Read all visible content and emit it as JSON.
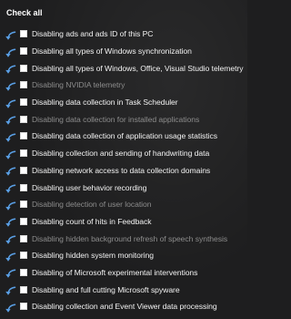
{
  "header": {
    "check_all_label": "Check all"
  },
  "items": [
    {
      "label": "Disabling ads and ads ID of this PC",
      "dim": false
    },
    {
      "label": "Disabling all types of Windows synchronization",
      "dim": false
    },
    {
      "label": "Disabling all types of Windows, Office, Visual Studio telemetry",
      "dim": false
    },
    {
      "label": "Disabling NVIDIA telemetry",
      "dim": true
    },
    {
      "label": "Disabling data collection in Task Scheduler",
      "dim": false
    },
    {
      "label": "Disabling data collection for installed applications",
      "dim": true
    },
    {
      "label": "Disabling data collection of application usage statistics",
      "dim": false
    },
    {
      "label": "Disabling collection and sending of handwriting data",
      "dim": false
    },
    {
      "label": "Disabling network access to data collection domains",
      "dim": false
    },
    {
      "label": "Disabling user behavior recording",
      "dim": false
    },
    {
      "label": "Disabling detection of user location",
      "dim": true
    },
    {
      "label": "Disabling count of hits in Feedback",
      "dim": false
    },
    {
      "label": "Disabling hidden background refresh of speech synthesis",
      "dim": true
    },
    {
      "label": "Disabling hidden system monitoring",
      "dim": false
    },
    {
      "label": "Disabling of Microsoft experimental interventions",
      "dim": false
    },
    {
      "label": "Disabling and full cutting Microsoft spyware",
      "dim": false
    },
    {
      "label": "Disabling collection and Event Viewer data processing",
      "dim": false
    }
  ],
  "colors": {
    "background": "#1e1e1f",
    "text": "#f2f2f2",
    "dim_text": "#8c8c8c",
    "undo_icon": "#5aa0e6"
  },
  "icons": {
    "row_icon": "undo-arrow-icon"
  }
}
